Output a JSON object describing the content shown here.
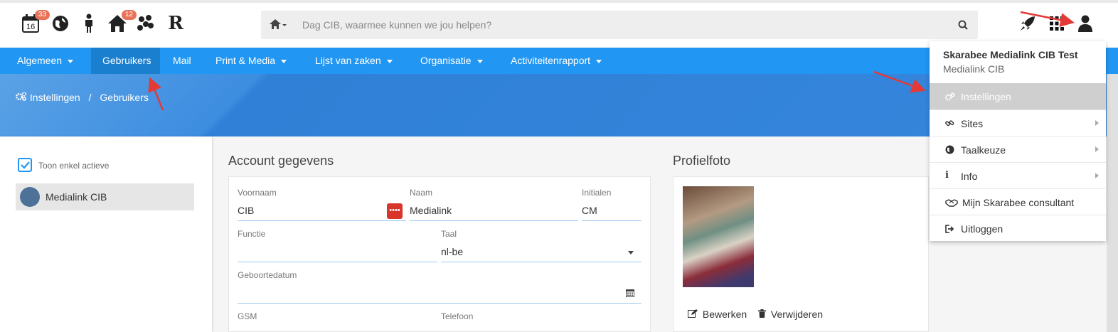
{
  "header": {
    "icons": [
      {
        "name": "calendar-icon",
        "day": "16",
        "badge": "33"
      },
      {
        "name": "globe-icon"
      },
      {
        "name": "person-icon"
      },
      {
        "name": "house-icon",
        "badge": "12"
      },
      {
        "name": "dots-icon"
      },
      {
        "name": "r-logo-icon",
        "letter": "R"
      }
    ],
    "search": {
      "placeholder": "Dag CIB, waarmee kunnen we jou helpen?"
    },
    "right_icons": [
      "rocket-icon",
      "apps-grid-icon",
      "user-icon"
    ]
  },
  "nav": {
    "items": [
      {
        "label": "Algemeen",
        "dropdown": true
      },
      {
        "label": "Gebruikers",
        "active": true
      },
      {
        "label": "Mail"
      },
      {
        "label": "Print & Media",
        "dropdown": true
      },
      {
        "label": "Lijst van zaken",
        "dropdown": true
      },
      {
        "label": "Organisatie",
        "dropdown": true
      },
      {
        "label": "Activiteitenrapport",
        "dropdown": true
      }
    ]
  },
  "breadcrumb": {
    "root": "Instellingen",
    "separator": "/",
    "current": "Gebruikers"
  },
  "sidebar": {
    "filter_label": "Toon enkel actieve",
    "filter_checked": true,
    "users": [
      {
        "label": "Medialink CIB"
      }
    ]
  },
  "account": {
    "title": "Account gegevens",
    "fields": {
      "voornaam": {
        "label": "Voornaam",
        "value": "CIB"
      },
      "naam": {
        "label": "Naam",
        "value": "Medialink"
      },
      "initialen": {
        "label": "Initialen",
        "value": "CM"
      },
      "functie": {
        "label": "Functie",
        "value": ""
      },
      "taal": {
        "label": "Taal",
        "value": "nl-be"
      },
      "geboortedatum": {
        "label": "Geboortedatum",
        "value": ""
      },
      "gsm": {
        "label": "GSM"
      },
      "telefoon": {
        "label": "Telefoon"
      }
    },
    "password_button": "••••"
  },
  "profile": {
    "title": "Profielfoto",
    "edit_label": "Bewerken",
    "delete_label": "Verwijderen"
  },
  "user_menu": {
    "name": "Skarabee Medialink CIB Test",
    "org": "Medialink CIB",
    "items": [
      {
        "label": "Instellingen",
        "icon": "gears-icon",
        "highlighted": true
      },
      {
        "label": "Sites",
        "icon": "link-icon",
        "submenu": true
      },
      {
        "label": "Taalkeuze",
        "icon": "globe-icon",
        "submenu": true
      },
      {
        "label": "Info",
        "icon": "info-icon",
        "submenu": true
      },
      {
        "label": "Mijn Skarabee consultant",
        "icon": "handshake-icon"
      },
      {
        "label": "Uitloggen",
        "icon": "sign-out-icon"
      }
    ]
  },
  "colors": {
    "primary": "#2196f3",
    "nav_active": "#1a7fcf",
    "badge": "#e8735a",
    "annotation_arrow": "#e53935"
  }
}
